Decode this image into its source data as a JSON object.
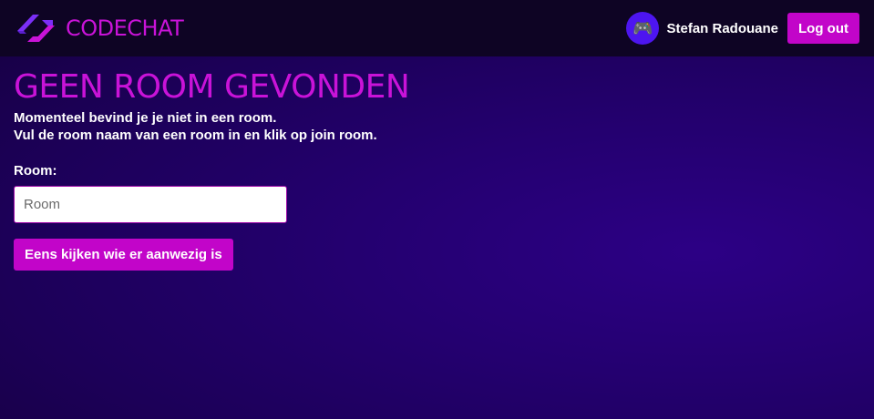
{
  "header": {
    "brand_name": "CODECHAT",
    "user_name": "Stefan Radouane",
    "avatar_glyph": "🎮",
    "logout_label": "Log out"
  },
  "main": {
    "title": "GEEN ROOM GEVONDEN",
    "intro_line1": "Momenteel bevind je je niet in een room.",
    "intro_line2": "Vul de room naam van een room in en klik op join room.",
    "room_label": "Room:",
    "room_placeholder": "Room",
    "room_value": "",
    "submit_label": "Eens kijken wie er aanwezig is"
  },
  "icons": {
    "brand": "codechat-logo-icon",
    "avatar": "gamepad-icon"
  },
  "colors": {
    "accent": "#c205c9",
    "brand_text": "#c913d8",
    "topbar": "#0e0424",
    "background": "#240070",
    "avatar_bg": "#4d15f0"
  }
}
